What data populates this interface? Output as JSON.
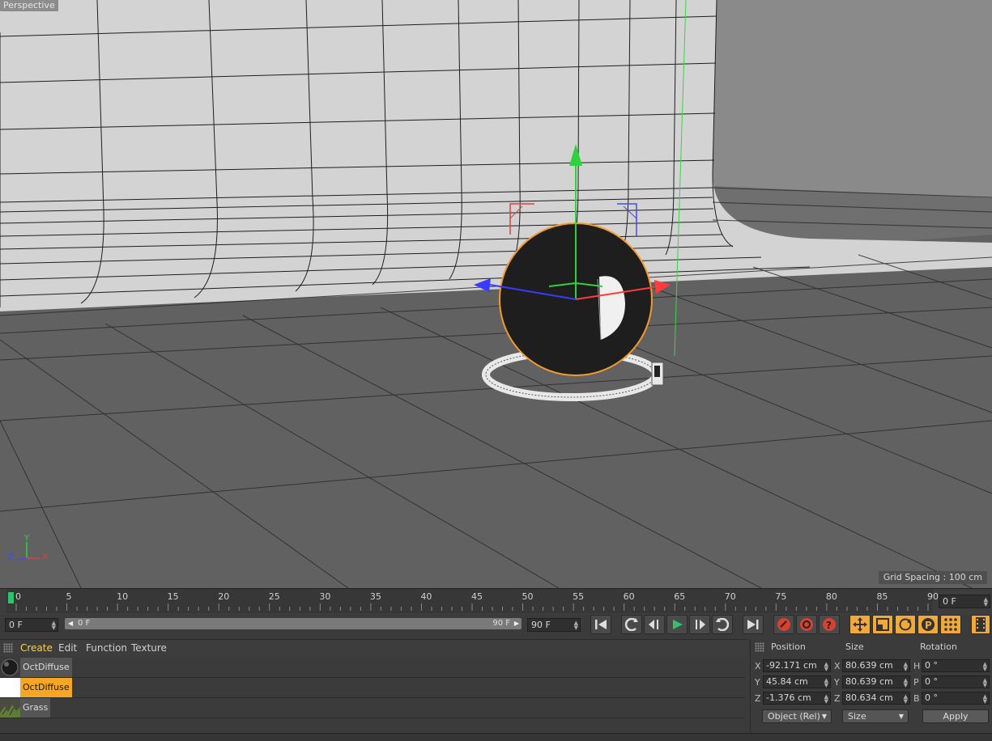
{
  "viewport": {
    "label": "Perspective",
    "grid_spacing": "Grid Spacing : 100 cm",
    "axis_labels": {
      "y": "Y",
      "z": "Z",
      "x": "X"
    }
  },
  "timeline": {
    "ruler_numbers": [
      "0",
      "5",
      "10",
      "15",
      "20",
      "25",
      "30",
      "35",
      "40",
      "45",
      "50",
      "55",
      "60",
      "65",
      "70",
      "75",
      "80",
      "85",
      "90"
    ],
    "current_frame": "0 F"
  },
  "transport": {
    "start_frame": "0 F",
    "range_start": "0 F",
    "range_end": "90 F",
    "end_frame": "90 F",
    "buttons": [
      "go-to-start",
      "previous-key",
      "previous-frame",
      "play",
      "next-frame",
      "next-key",
      "go-to-end",
      "record",
      "autokey",
      "keyframe-selection",
      "move",
      "scale",
      "rotate",
      "parameter",
      "point-level-animation",
      "timeline-scheme"
    ],
    "colors": {
      "play": "#2ec26a",
      "record": "#d8402f",
      "accent": "#f2a93b"
    }
  },
  "materials": {
    "menu": [
      "Create",
      "Edit",
      "Function",
      "Texture"
    ],
    "active_menu": "Create",
    "items": [
      {
        "name": "OctDiffuse",
        "thumb": "dark-sphere-icon",
        "selected": false
      },
      {
        "name": "OctDiffuse",
        "thumb": "white-swatch-icon",
        "selected": true
      },
      {
        "name": "Grass",
        "thumb": "grass-icon",
        "selected": false
      }
    ]
  },
  "coordinates": {
    "headers": {
      "position": "Position",
      "size": "Size",
      "rotation": "Rotation"
    },
    "rows": [
      {
        "pos_label": "X",
        "pos": "-92.171 cm",
        "size_label": "X",
        "size": "80.639 cm",
        "rot_label": "H",
        "rot": "0 °"
      },
      {
        "pos_label": "Y",
        "pos": "45.84 cm",
        "size_label": "Y",
        "size": "80.639 cm",
        "rot_label": "P",
        "rot": "0 °"
      },
      {
        "pos_label": "Z",
        "pos": "-1.376 cm",
        "size_label": "Z",
        "size": "80.634 cm",
        "rot_label": "B",
        "rot": "0 °"
      }
    ],
    "mode": "Object (Rel)",
    "size_mode": "Size",
    "apply": "Apply"
  }
}
